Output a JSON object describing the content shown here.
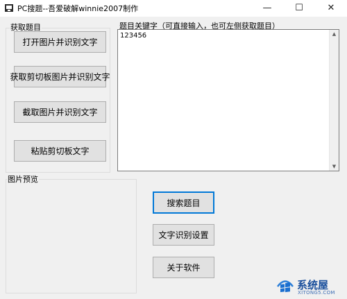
{
  "window": {
    "title": "PC搜题--吾爱破解winnie2007制作",
    "controls": {
      "minimize": "—",
      "maximize": "☐",
      "close": "✕"
    }
  },
  "acquire_group": {
    "label": "获取题目",
    "buttons": [
      "打开图片并识别文字",
      "获取剪切板图片并识别文字",
      "截取图片并识别文字",
      "粘贴剪切板文字"
    ]
  },
  "keyword": {
    "label": "题目关键字（可直接输入，也可左侧获取题目）",
    "value": "123456"
  },
  "preview": {
    "label": "图片预览"
  },
  "actions": {
    "search": "搜索题目",
    "ocr_settings": "文字识别设置",
    "about": "关于软件"
  },
  "watermark": {
    "text": "系统屋",
    "url": "XITONG5.COM"
  },
  "colors": {
    "button_bg": "#e1e1e1",
    "focus_border": "#0078d7",
    "watermark": "#1a4f9c"
  }
}
